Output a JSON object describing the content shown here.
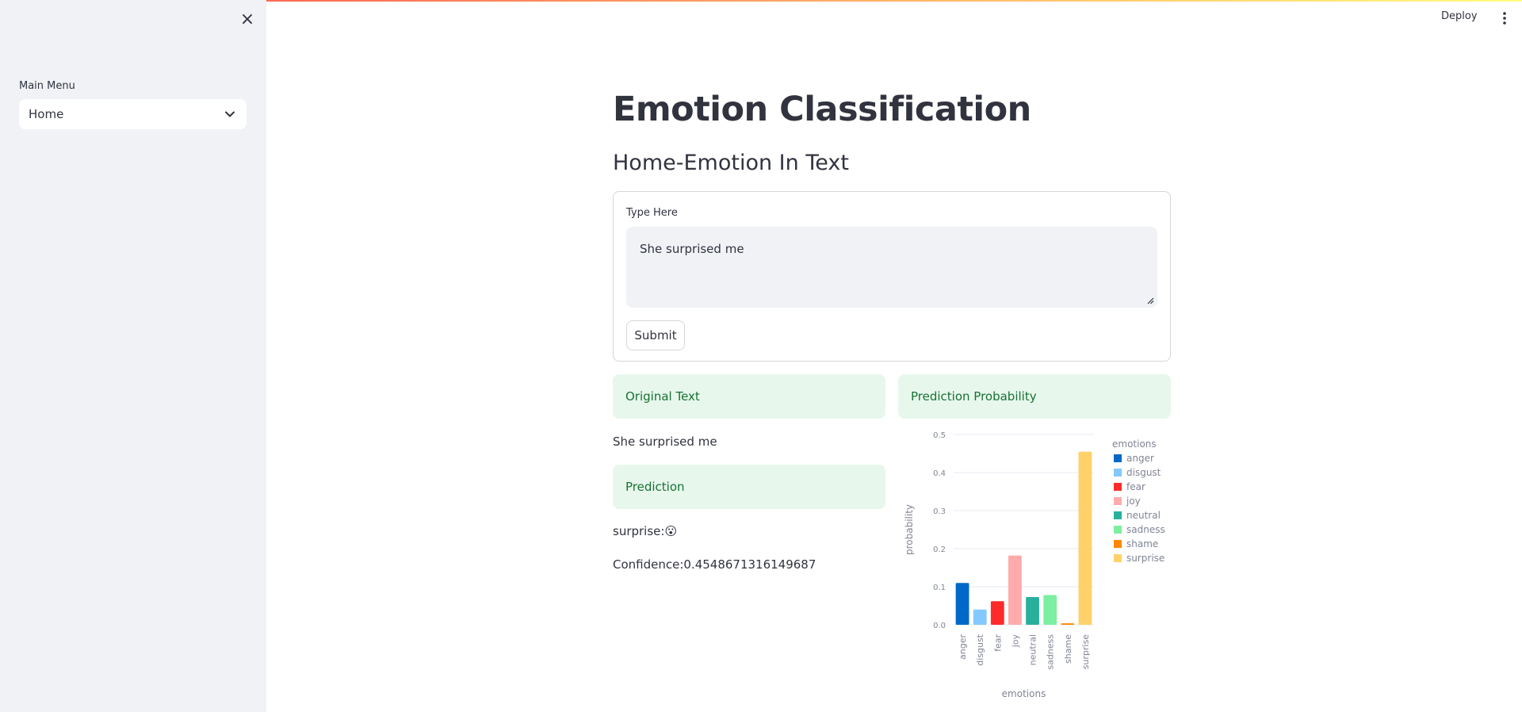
{
  "sidebar": {
    "close_glyph": "×",
    "menu_label": "Main Menu",
    "menu_value": "Home"
  },
  "header": {
    "deploy_label": "Deploy"
  },
  "main": {
    "title": "Emotion Classification",
    "subtitle": "Home-Emotion In Text",
    "form": {
      "label": "Type Here",
      "text": "She surprised me",
      "submit_label": "Submit"
    },
    "left": {
      "original_header": "Original Text",
      "original_text": "She surprised me",
      "prediction_header": "Prediction",
      "prediction_text": "surprise:",
      "prediction_emoji": "😮",
      "confidence_text": "Confidence:0.4548671316149687"
    },
    "right": {
      "prob_header": "Prediction Probability"
    }
  },
  "colors": {
    "success_bg": "#e7f7ec",
    "success_text": "#177233",
    "sidebar_bg": "#f0f2f6"
  },
  "chart_data": {
    "type": "bar",
    "categories": [
      "anger",
      "disgust",
      "fear",
      "joy",
      "neutral",
      "sadness",
      "shame",
      "surprise"
    ],
    "values": [
      0.11,
      0.04,
      0.062,
      0.182,
      0.073,
      0.078,
      0.004,
      0.455
    ],
    "colors": [
      "#0068c9",
      "#83c9ff",
      "#ff2b2b",
      "#ffabab",
      "#29b09d",
      "#7defa1",
      "#ff8700",
      "#ffd16a"
    ],
    "xlabel": "emotions",
    "ylabel": "probability",
    "ylim": [
      0,
      0.5
    ],
    "yticks": [
      "0.0",
      "0.1",
      "0.2",
      "0.3",
      "0.4",
      "0.5"
    ],
    "legend_title": "emotions",
    "legend_position": "right",
    "grid": true
  }
}
